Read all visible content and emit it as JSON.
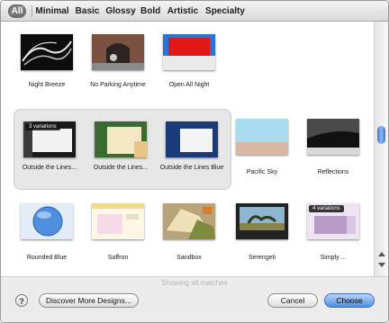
{
  "tabs": [
    "All",
    "Minimal",
    "Basic",
    "Glossy",
    "Bold",
    "Artistic",
    "Specialty"
  ],
  "themes": [
    {
      "label": "Night Breeze",
      "icon": "night-breeze-thumbnail"
    },
    {
      "label": "No Parking Anytime",
      "icon": "no-parking-anytime-thumbnail"
    },
    {
      "label": "Open All Night",
      "icon": "open-all-night-thumbnail"
    },
    {
      "label": "Outside the Lines...",
      "icon": "outside-the-lines-thumbnail"
    },
    {
      "label": "Outside the Lines...",
      "icon": "outside-the-lines-2-thumbnail"
    },
    {
      "label": "Outside the Lines Blue",
      "icon": "outside-the-lines-blue-thumbnail"
    },
    {
      "label": "Pacific Sky",
      "icon": "pacific-sky-thumbnail"
    },
    {
      "label": "Reflections",
      "icon": "reflections-thumbnail"
    },
    {
      "label": "Rounded Blue",
      "icon": "rounded-blue-thumbnail"
    },
    {
      "label": "Saffron",
      "icon": "saffron-thumbnail"
    },
    {
      "label": "Sandbox",
      "icon": "sandbox-thumbnail"
    },
    {
      "label": "Serengeti",
      "icon": "serengeti-thumbnail"
    },
    {
      "label": "Simply ...",
      "icon": "simply-thumbnail"
    }
  ],
  "badges": {
    "outside_the_lines": "3 variations",
    "simply": "4 variations"
  },
  "status": "Showing all matches",
  "footer": {
    "help": "?",
    "discover": "Discover More Designs...",
    "cancel": "Cancel",
    "choose": "Choose"
  }
}
